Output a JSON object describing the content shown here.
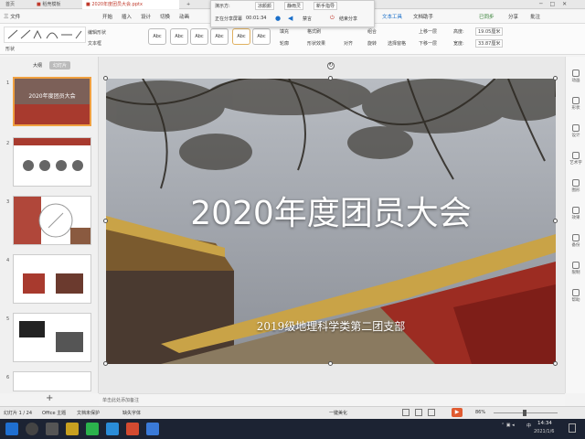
{
  "titlebar": {
    "tabs": [
      {
        "label": "首页"
      },
      {
        "label": "稻壳模板"
      },
      {
        "label": "2020年度团员大会.pptx"
      }
    ],
    "add_tab": "+"
  },
  "share_bar": {
    "presenter_label": "演示方:",
    "viewer_name": "凉颜颜",
    "recording_label": "正在分享屏幕",
    "timer": "00:01:34",
    "host_label": "静雨灵",
    "status_label": "暂停",
    "newbie_label": "新手指导",
    "mute_label": "禁言",
    "end_label": "结束分享"
  },
  "ribbon": {
    "menu_label": "三 文件",
    "tabs": [
      "开始",
      "插入",
      "设计",
      "切换",
      "动画",
      "幻灯片放映",
      "审阅",
      "视图",
      "安全",
      "开发工具",
      "特色功能",
      "绘图工具",
      "文本工具",
      "文档助手"
    ],
    "search_placeholder": "查找命令、搜索模板",
    "right_items": [
      "已同步",
      "分享",
      "批注"
    ]
  },
  "toolbar": {
    "shape_label": "形状",
    "edit_shape": "编辑形状",
    "textbox": "文本框",
    "style_boxes": [
      "Abc",
      "Abc",
      "Abc",
      "Abc",
      "Abc",
      "Abc"
    ],
    "fill": "填充",
    "outline": "轮廓",
    "shape_effect": "形状效果",
    "format_brush": "格式刷",
    "align": "对齐",
    "group": "组合",
    "rotate": "旋转",
    "select_pane": "选择窗格",
    "bring_forward": "上移一层",
    "send_backward": "下移一层",
    "height_label": "高度:",
    "height_value": "19.05厘米",
    "width_label": "宽度:",
    "width_value": "33.87厘米"
  },
  "sidebar": {
    "outline_tab": "大纲",
    "slides_tab": "幻灯片",
    "thumbnails": [
      {
        "num": "1"
      },
      {
        "num": "2"
      },
      {
        "num": "3"
      },
      {
        "num": "4"
      },
      {
        "num": "5"
      },
      {
        "num": "6"
      }
    ],
    "add_slide": "+"
  },
  "slide": {
    "title": "2020年度团员大会",
    "subtitle": "2019级地理科学类第二团支部"
  },
  "right_panel": {
    "items": [
      "动画",
      "形状",
      "设计",
      "艺术字",
      "图形",
      "效果",
      "备份",
      "限制",
      "帮助",
      "设置"
    ]
  },
  "notes": {
    "placeholder": "单击此处添加备注"
  },
  "status": {
    "slide_index": "幻灯片 1 / 24",
    "theme": "Office 主题",
    "backup": "文档未保护",
    "font_missing": "缺失字体",
    "beautify": "一键美化",
    "zoom": "86%"
  },
  "taskbar": {
    "time": "14:34",
    "date": "2021/1/6",
    "ime": "中"
  },
  "colors": {
    "accent": "#c0392b",
    "slide_bg": "#9aa0a8",
    "taskbar": "#1c2333"
  }
}
